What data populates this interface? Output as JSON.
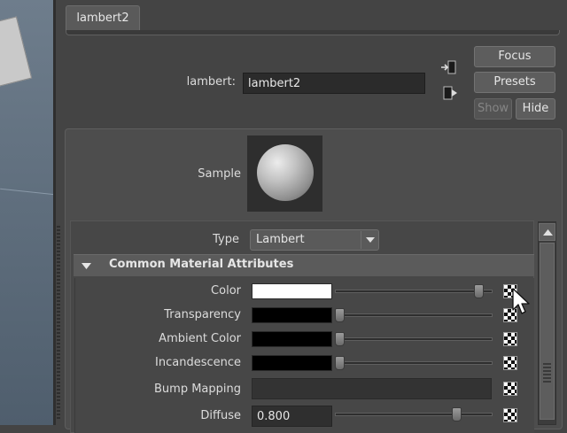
{
  "tab": {
    "label": "lambert2"
  },
  "node": {
    "type_label": "lambert:",
    "name_value": "lambert2"
  },
  "buttons": {
    "focus": "Focus",
    "presets": "Presets",
    "show": "Show",
    "hide": "Hide"
  },
  "sample": {
    "label": "Sample"
  },
  "type_row": {
    "label": "Type",
    "selected": "Lambert"
  },
  "section": {
    "title": "Common Material Attributes"
  },
  "attributes": [
    {
      "label": "Color",
      "swatch": "#ffffff",
      "slider": 0.95
    },
    {
      "label": "Transparency",
      "swatch": "#000000",
      "slider": 0.0
    },
    {
      "label": "Ambient Color",
      "swatch": "#000000",
      "slider": 0.0
    },
    {
      "label": "Incandescence",
      "swatch": "#000000",
      "slider": 0.0
    },
    {
      "label": "Bump Mapping"
    },
    {
      "label": "Diffuse",
      "value": "0.800",
      "slider": 0.8
    }
  ],
  "icons": {
    "input_connections": "input-connection-icon",
    "output_connections": "output-connection-icon",
    "map_button": "checker-map-icon",
    "cursor": "mouse-pointer-icon"
  }
}
